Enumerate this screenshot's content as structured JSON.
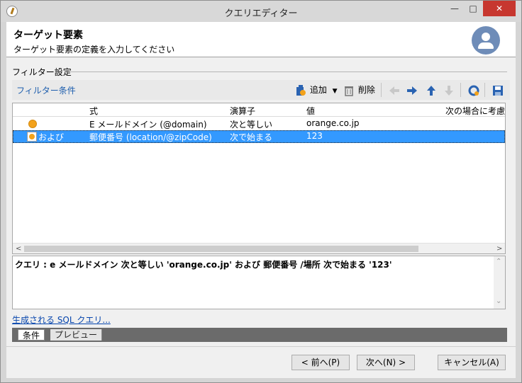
{
  "window": {
    "title": "クエリエディター",
    "controls": {
      "minimize": "—",
      "maximize": "□",
      "close": "✕"
    }
  },
  "header": {
    "title": "ターゲット要素",
    "subtitle": "ターゲット要素の定義を入力してください"
  },
  "filter_group": {
    "label": "フィルター設定",
    "caption": "フィルター条件",
    "toolbar": {
      "add_label": "追加",
      "delete_label": "削除",
      "icons": [
        "add-icon",
        "dropdown-arrow-icon",
        "trash-icon",
        "arrow-left-icon",
        "arrow-right-icon",
        "arrow-up-icon",
        "arrow-down-icon",
        "refresh-icon",
        "save-icon"
      ]
    }
  },
  "grid": {
    "columns": [
      "式",
      "演算子",
      "値",
      "次の場合に考慮"
    ],
    "rows": [
      {
        "prefix": "",
        "expression": "E メールドメイン (@domain)",
        "operator": "次と等しい",
        "value": "orange.co.jp",
        "selected": false
      },
      {
        "prefix": "および",
        "expression": "郵便番号 (location/@zipCode)",
        "operator": "次で始まる",
        "value": "123",
        "selected": true
      }
    ]
  },
  "query": {
    "text": "クエリ : e メールドメイン 次と等しい 'orange.co.jp' および 郵便番号 /場所 次で始まる '123'"
  },
  "sql_link": "生成される SQL クエリ...",
  "tabs": {
    "conditions": "条件",
    "preview": "プレビュー"
  },
  "buttons": {
    "prev": "< 前へ(P)",
    "next": "次へ(N) >",
    "cancel": "キャンセル(A)"
  },
  "colors": {
    "selection": "#3399ff",
    "link": "#0645ad",
    "accent_orange": "#f3a21b",
    "close_button": "#c7372f"
  }
}
